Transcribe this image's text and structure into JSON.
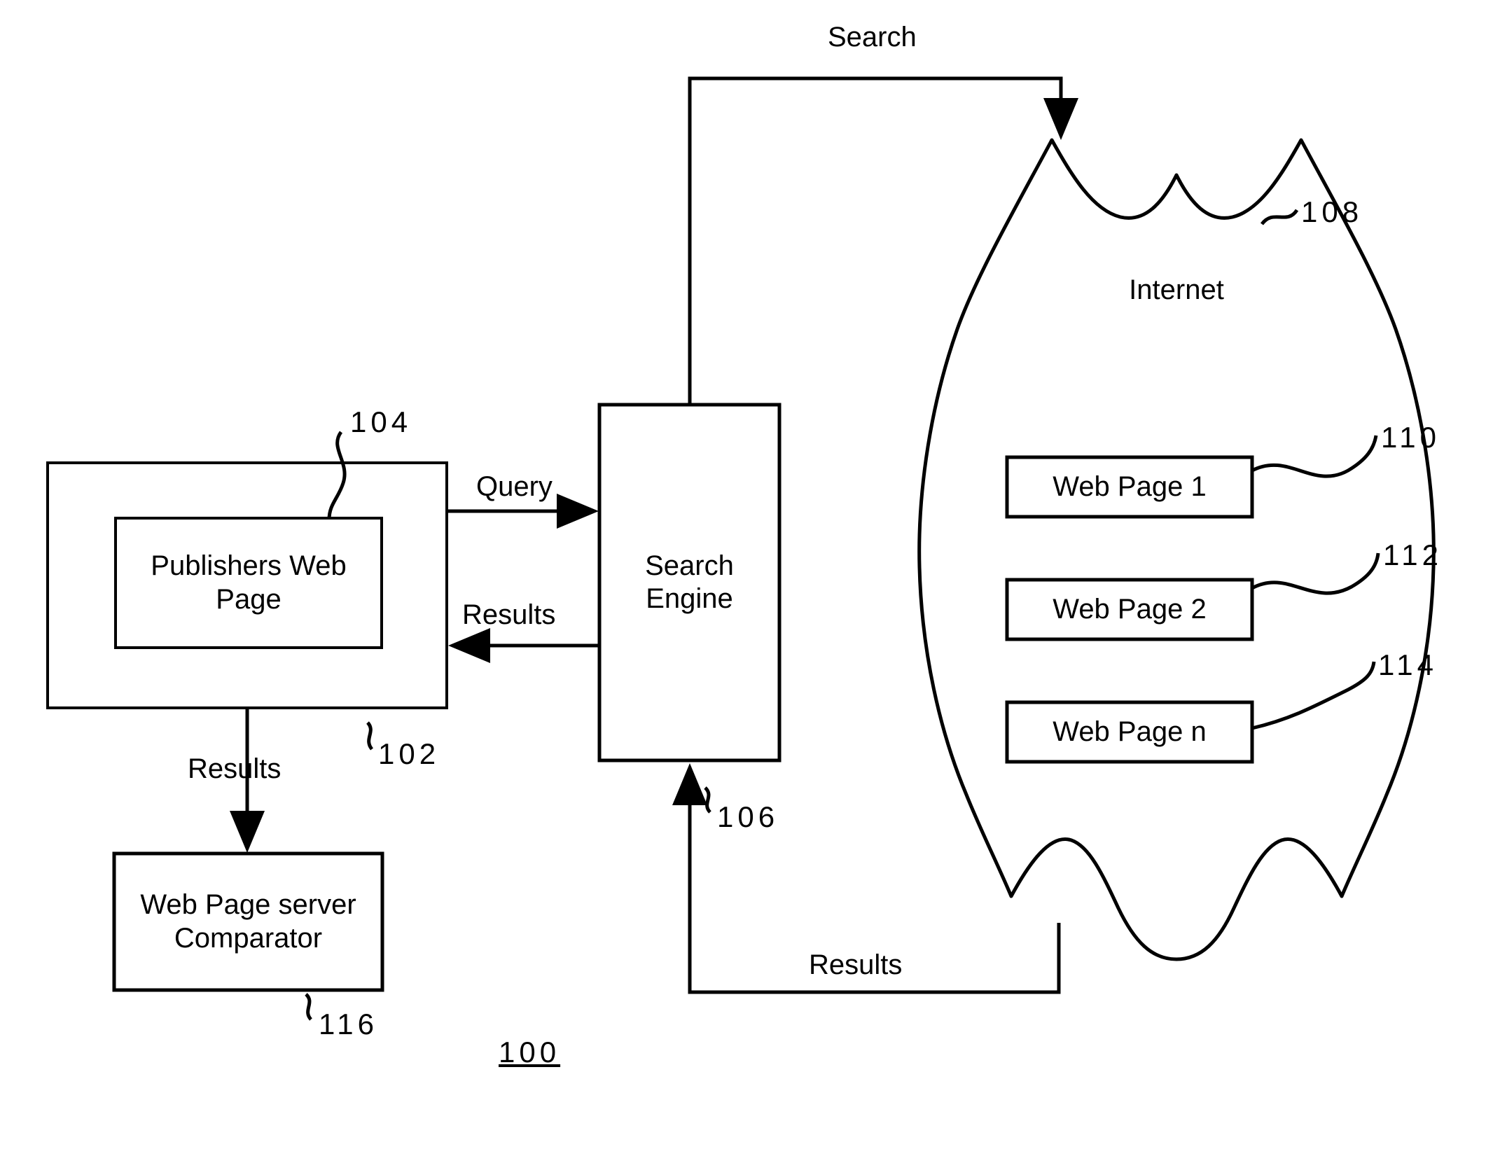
{
  "figure": {
    "number": "100",
    "title": "Search engine system block diagram"
  },
  "nodes": {
    "publishers_web_page": {
      "label": "Publishers Web\nPage",
      "ref": "104"
    },
    "publishers_server": {
      "label": "",
      "ref": "102"
    },
    "search_engine": {
      "label": "Search\nEngine",
      "ref": "106"
    },
    "internet": {
      "label": "Internet",
      "ref": "108"
    },
    "web_page_1": {
      "label": "Web Page 1",
      "ref": "110"
    },
    "web_page_2": {
      "label": "Web Page 2",
      "ref": "112"
    },
    "web_page_n": {
      "label": "Web Page n",
      "ref": "114"
    },
    "comparator": {
      "label": "Web Page server\nComparator",
      "ref": "116"
    }
  },
  "edges": {
    "search": "Search",
    "query": "Query",
    "results_engine_to_publisher": "Results",
    "results_publisher_to_comparator": "Results",
    "results_internet_to_engine": "Results"
  },
  "style": {
    "stroke": "#000000",
    "background": "#ffffff",
    "stroke_width": 4
  }
}
